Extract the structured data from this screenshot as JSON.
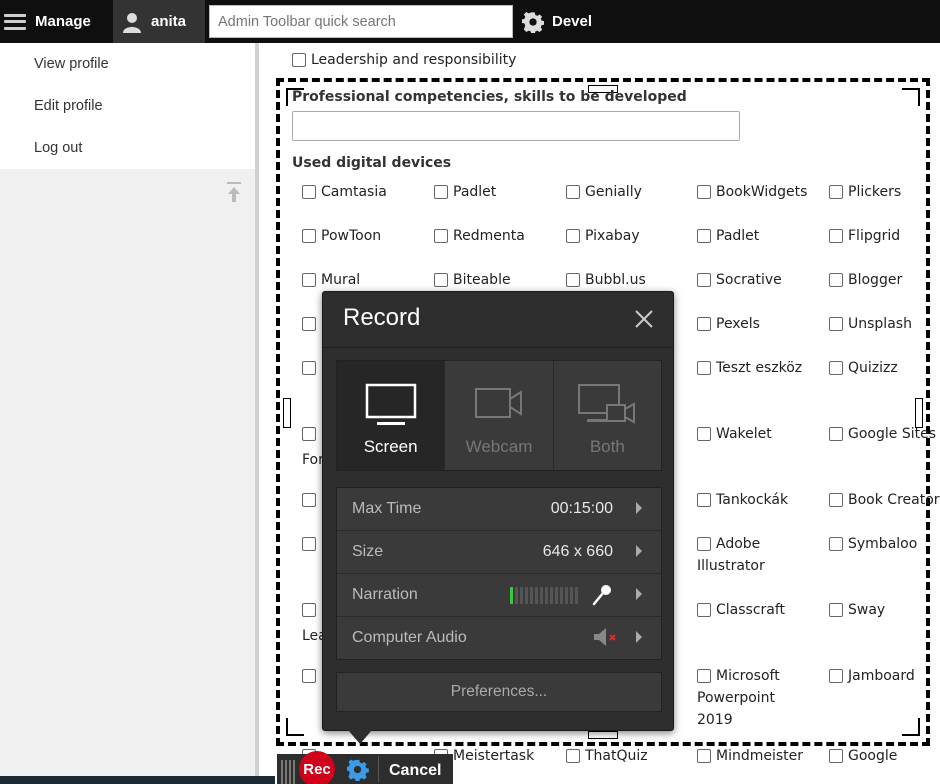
{
  "toolbar": {
    "manage_label": "Manage",
    "user_label": "anita",
    "search_placeholder": "Admin Toolbar quick search",
    "devel_label": "Devel"
  },
  "tray": {
    "links": [
      "View profile",
      "Edit profile",
      "Log out"
    ]
  },
  "form": {
    "top_option": "Leadership and responsibility",
    "competencies_label": "Professional competencies, skills to be developed",
    "devices_label": "Used digital devices",
    "devices": [
      [
        "Camtasia",
        "Padlet",
        "Genially",
        "BookWidgets",
        "Plickers"
      ],
      [
        "PowToon",
        "Redmenta",
        "Pixabay",
        "Padlet",
        "Flipgrid"
      ],
      [
        "Mural",
        "Biteable",
        "Bubbl.us",
        "Socrative",
        "Blogger"
      ],
      [
        "Pexels",
        "Unsplash"
      ],
      [
        "Teszt eszköz",
        "Quizizz"
      ],
      [
        "Wakelet",
        "Google Sites"
      ],
      [
        "Tankockák",
        "Book Creator"
      ],
      [
        "Adobe Illustrator",
        "Symbaloo"
      ],
      [
        "Classcraft",
        "Sway"
      ],
      [
        "Microsoft Powerpoint 2019",
        "Jamboard"
      ],
      [
        "Meistertask",
        "ThatQuiz",
        "Mindmeister",
        "Google"
      ]
    ],
    "partial_left": [
      "For",
      "Lea"
    ]
  },
  "recorder": {
    "title": "Record",
    "sources": [
      "Screen",
      "Webcam",
      "Both"
    ],
    "active_source": "Screen",
    "max_time_label": "Max Time",
    "max_time_value": "00:15:00",
    "size_label": "Size",
    "size_value": "646 x 660",
    "narration_label": "Narration",
    "narration_level": 0.1,
    "computer_audio_label": "Computer Audio",
    "computer_audio_muted": true,
    "preferences_label": "Preferences...",
    "colors": {
      "panel": "#2e2e2e",
      "meter_on": "#39c93a",
      "rec": "#d0021b"
    }
  },
  "recbar": {
    "rec_label": "Rec",
    "cancel_label": "Cancel"
  }
}
